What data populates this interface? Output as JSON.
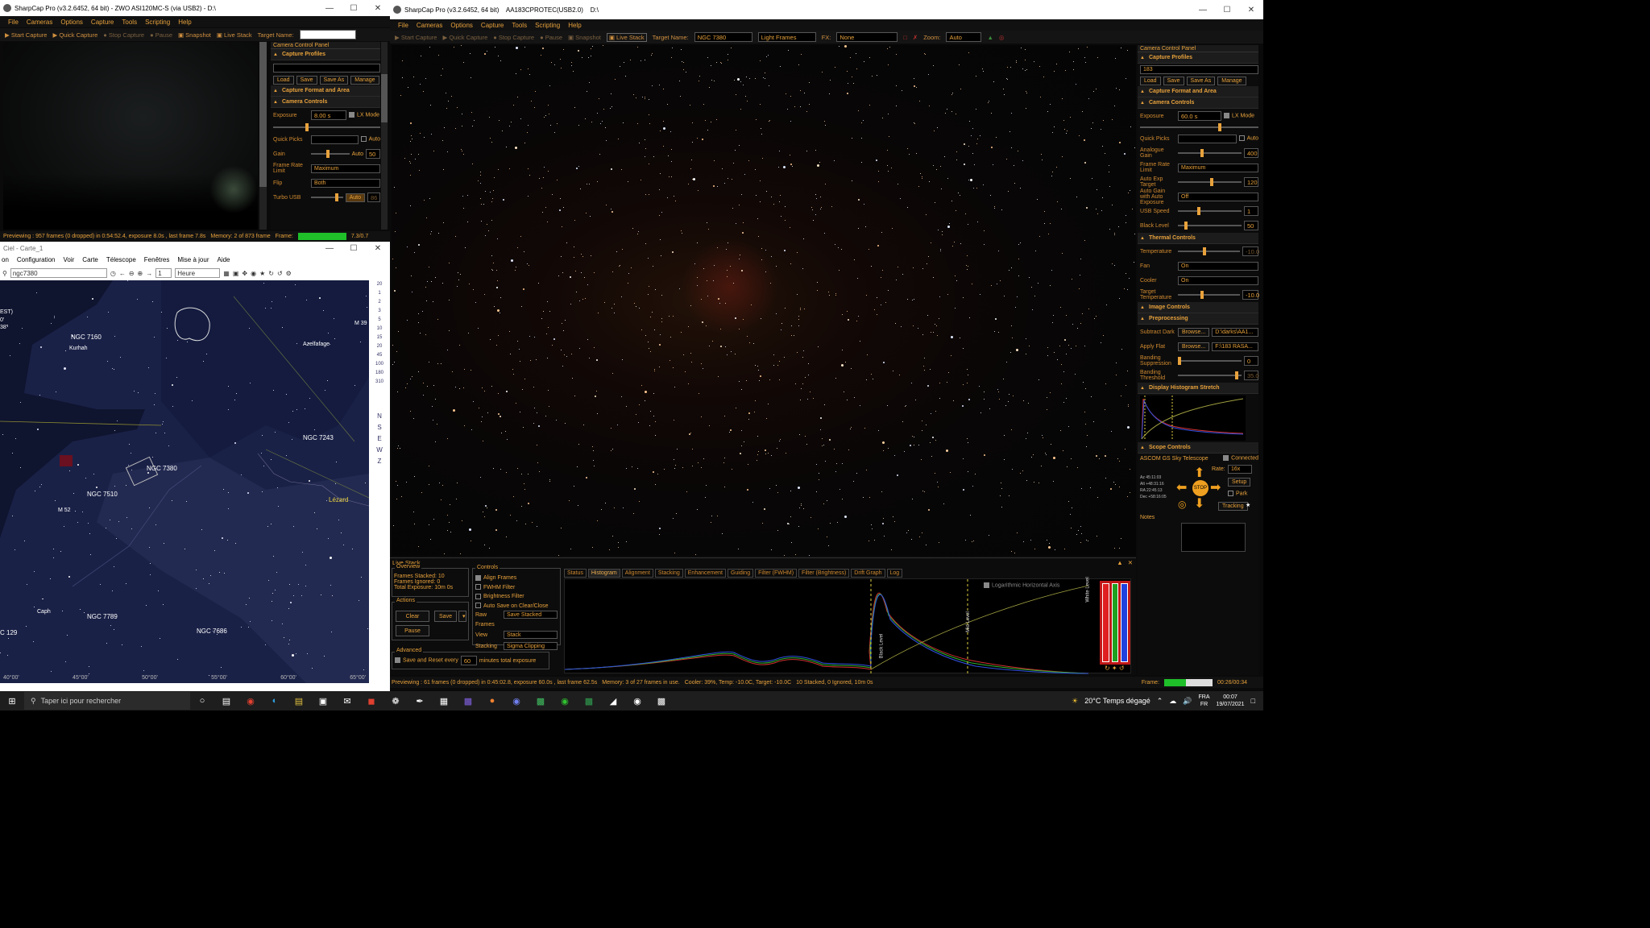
{
  "left_window": {
    "title": "SharpCap Pro (v3.2.6452, 64 bit) - ZWO ASI120MC-S (via USB2) - D:\\",
    "menu": [
      "File",
      "Cameras",
      "Options",
      "Capture",
      "Tools",
      "Scripting",
      "Help"
    ],
    "toolbar": {
      "start": "Start Capture",
      "quick": "Quick Capture",
      "stop": "Stop Capture",
      "pause": "Pause",
      "snapshot": "Snapshot",
      "live": "Live Stack",
      "target_label": "Target Name:"
    },
    "panel_title": "Camera Control Panel",
    "sections": {
      "profiles": "Capture Profiles",
      "format": "Capture Format and Area",
      "controls": "Camera Controls"
    },
    "profile_buttons": [
      "Load",
      "Save",
      "Save As",
      "Manage"
    ],
    "exposure_label": "Exposure",
    "exposure_value": "8.00 s",
    "lx_mode": "LX Mode",
    "quick_picks": "Quick Picks",
    "auto": "Auto",
    "gain_label": "Gain",
    "gain_value": "50",
    "frame_rate_label": "Frame Rate Limit",
    "frame_rate_value": "Maximum",
    "flip_label": "Flip",
    "flip_value": "Both",
    "turbo_label": "Turbo USB",
    "turbo_value": "86",
    "status": "Previewing : 957 frames (0 dropped) in 0:54:52.4, exposure 8.0s , last frame 7.8s",
    "memory": "Memory: 2 of 873 frame",
    "frame_label": "Frame:",
    "frame_value": "7.3/0.7"
  },
  "ciel": {
    "title": "Ciel - Carte_1",
    "menu": [
      "on",
      "Configuration",
      "Voir",
      "Carte",
      "Télescope",
      "Fenêtres",
      "Mise à jour",
      "Aide"
    ],
    "search": "ngc7380",
    "step_value": "1",
    "unit": "Heure",
    "labels": {
      "ngc7160": "NGC 7160",
      "kurhah": "Kurhah",
      "azelfafage": "Azelfafage",
      "m39": "M 39",
      "ngc7243": "NGC 7243",
      "ngc7380": "NGC 7380",
      "ngc7510": "NGC 7510",
      "lezard": "Lézard",
      "m52": "M 52",
      "caph": "Caph",
      "ngc7789": "NGC 7789",
      "ngc7686": "NGC 7686",
      "ngc129": "C 129",
      "est": "EST)",
      "deg0": "0'",
      "deg38": "38\""
    },
    "ra_ticks": [
      "40°00'",
      "45°00'",
      "50°00'",
      "55°00'",
      "60°00'",
      "65°00'"
    ],
    "side_numbers": [
      "20",
      "1",
      "2",
      "3",
      "5",
      "10",
      "15",
      "20",
      "45",
      "100",
      "180",
      "310"
    ],
    "compass": [
      "N",
      "S",
      "E",
      "W",
      "Z"
    ]
  },
  "main_window": {
    "title": "SharpCap Pro (v3.2.6452, 64 bit)    AA183CPROTEC(USB2.0)    D:\\",
    "menu": [
      "File",
      "Cameras",
      "Options",
      "Capture",
      "Tools",
      "Scripting",
      "Help"
    ],
    "toolbar": {
      "start": "Start Capture",
      "quick": "Quick Capture",
      "stop": "Stop Capture",
      "pause": "Pause",
      "snapshot": "Snapshot",
      "live": "Live Stack",
      "target_label": "Target Name:",
      "target_value": "NGC 7380",
      "frame_type": "Light Frames",
      "fx_label": "FX:",
      "fx_value": "None",
      "zoom_label": "Zoom:",
      "zoom_value": "Auto"
    },
    "status": "Previewing : 61 frames (0 dropped) in 0:45:02.8, exposure 60.0s , last frame 62.5s",
    "memory": "Memory: 3 of 27 frames in use.",
    "cooler": "Cooler: 39%, Temp: -10.0C, Target: -10.0C",
    "stacked": "10 Stacked, 0 Ignored, 10m 0s",
    "frame_label": "Frame:",
    "frame_value": "00:26/00:34"
  },
  "live_stack": {
    "title": "Live Stack",
    "overview_title": "Overview",
    "frames_stacked_label": "Frames Stacked:",
    "frames_stacked": "10",
    "frames_ignored_label": "Frames Ignored:",
    "frames_ignored": "0",
    "total_exposure_label": "Total Exposure:",
    "total_exposure": "10m 0s",
    "actions_title": "Actions",
    "clear": "Clear",
    "save": "Save",
    "pause": "Pause",
    "controls_title": "Controls",
    "align": "Align Frames",
    "fwhm": "FWHM Filter",
    "brightness": "Brightness Filter",
    "autosave": "Auto Save on Clear/Close",
    "raw_label": "Raw Frames",
    "raw_value": "Save Stacked",
    "view_label": "View",
    "view_value": "Stack",
    "stacking_label": "Stacking",
    "stacking_value": "Sigma Clipping",
    "advanced_title": "Advanced",
    "save_reset": "Save and Reset every",
    "minutes_value": "60",
    "minutes_label": "minutes total exposure",
    "tabs": [
      "Status",
      "Histogram",
      "Alignment",
      "Stacking",
      "Enhancement",
      "Guiding",
      "Filter (FWHM)",
      "Filter (Brightness)",
      "Drift Graph",
      "Log"
    ],
    "active_tab": "Histogram",
    "log_axis": "Logarithmic Horizontal Axis",
    "black_level": "Black Level",
    "mid_level": "Mid Level",
    "white_level": "White Level"
  },
  "right_panel": {
    "title": "Camera Control Panel",
    "sections": {
      "profiles": "Capture Profiles",
      "format": "Capture Format and Area",
      "controls": "Camera Controls",
      "thermal": "Thermal Controls",
      "image": "Image Controls",
      "preprocessing": "Preprocessing",
      "histogram": "Display Histogram Stretch",
      "scope": "Scope Controls"
    },
    "profile_value": "183",
    "profile_buttons": [
      "Load",
      "Save",
      "Save As",
      "Manage"
    ],
    "exposure_label": "Exposure",
    "exposure_value": "60.0 s",
    "lx_mode": "LX Mode",
    "quick_picks": "Quick Picks",
    "auto": "Auto",
    "gain_label": "Analogue Gain",
    "gain_value": "400",
    "frame_rate_label": "Frame Rate Limit",
    "frame_rate_value": "Maximum",
    "auto_exp_label": "Auto Exp Target",
    "auto_exp_value": "120",
    "auto_gain_label": "Auto Gain with Auto Exposure",
    "auto_gain_value": "Off",
    "usb_label": "USB Speed",
    "usb_value": "1",
    "black_label": "Black Level",
    "black_value": "50",
    "temp_label": "Temperature",
    "temp_value": "-10.0",
    "fan_label": "Fan",
    "fan_value": "On",
    "cooler_label": "Cooler",
    "cooler_value": "On",
    "target_temp_label": "Target Temperature",
    "target_temp_value": "-10.0",
    "dark_label": "Subtract Dark",
    "browse": "Browse...",
    "dark_value": "D:\\darks\\AA1...",
    "flat_label": "Apply Flat",
    "flat_value": "F:\\183 RASA...",
    "banding_sup_label": "Banding Suppression",
    "banding_sup_value": "0",
    "banding_thr_label": "Banding Threshold",
    "banding_thr_value": "35.0",
    "scope_name": "ASCOM GS Sky Telescope",
    "connected": "Connected",
    "rate_label": "Rate:",
    "rate_value": "16x",
    "setup": "Setup",
    "park": "Park",
    "stop": "STOP",
    "tracking": "Tracking",
    "coords": [
      "Az  45:11:03",
      "Alt +48:31:16",
      "RA  22:45:13",
      "Dec +58:16:05"
    ],
    "notes": "Notes"
  },
  "taskbar": {
    "search": "Taper ici pour rechercher",
    "weather": "20°C  Temps dégagé",
    "lang": "FRA",
    "region": "FR",
    "time": "00:07",
    "date": "19/07/2021"
  },
  "colors": {
    "accent": "#e8a23c",
    "bg": "#0a0a0a",
    "sky": "#16204a"
  }
}
